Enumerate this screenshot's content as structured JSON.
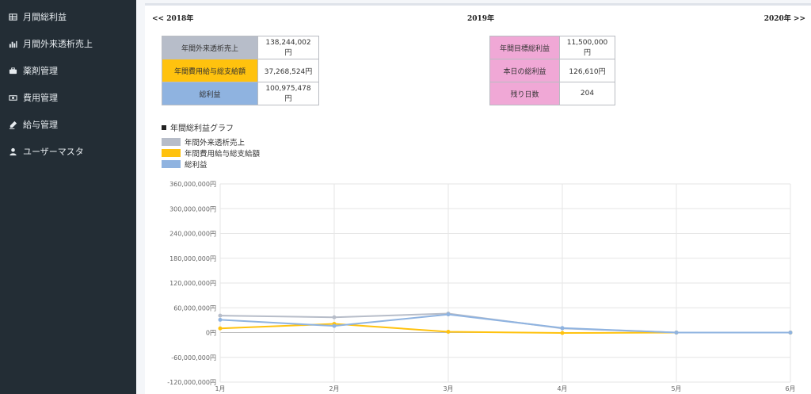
{
  "sidebar": {
    "items": [
      {
        "label": "月間総利益",
        "icon": "table-icon"
      },
      {
        "label": "月間外来透析売上",
        "icon": "bar-chart-icon"
      },
      {
        "label": "薬剤管理",
        "icon": "briefcase-icon"
      },
      {
        "label": "費用管理",
        "icon": "money-icon"
      },
      {
        "label": "給与管理",
        "icon": "pen-icon"
      },
      {
        "label": "ユーザーマスタ",
        "icon": "user-icon"
      }
    ]
  },
  "year_nav": {
    "prev": "<< 2018年",
    "current": "2019年",
    "next": "2020年 >>"
  },
  "summary_left": [
    {
      "label": "年間外来透析売上",
      "value": "138,244,002円",
      "color": "#b7bdc9"
    },
    {
      "label": "年間費用給与総支給額",
      "value": "37,268,524円",
      "color": "#ffc20e"
    },
    {
      "label": "総利益",
      "value": "100,975,478円",
      "color": "#8fb3e0"
    }
  ],
  "summary_right": [
    {
      "label": "年間目標総利益",
      "value": "11,500,000円",
      "color": "#f0a8d6"
    },
    {
      "label": "本日の総利益",
      "value": "126,610円",
      "color": "#f0a8d6"
    },
    {
      "label": "残り日数",
      "value": "204",
      "color": "#f0a8d6"
    }
  ],
  "graph_title": "年間総利益グラフ",
  "chart_data": {
    "type": "line",
    "title": "",
    "x": [
      "1月",
      "2月",
      "3月",
      "4月",
      "5月",
      "6月"
    ],
    "ylim": [
      -120000000,
      360000000
    ],
    "yticks": [
      {
        "value": 360000000,
        "label": "360,000,000円"
      },
      {
        "value": 300000000,
        "label": "300,000,000円"
      },
      {
        "value": 240000000,
        "label": "240,000,000円"
      },
      {
        "value": 180000000,
        "label": "180,000,000円"
      },
      {
        "value": 120000000,
        "label": "120,000,000円"
      },
      {
        "value": 60000000,
        "label": "60,000,000円"
      },
      {
        "value": 0,
        "label": "0円"
      },
      {
        "value": -60000000,
        "label": "-60,000,000円"
      },
      {
        "value": -120000000,
        "label": "-120,000,000円"
      }
    ],
    "grid": true,
    "legend_position": "top-left",
    "series": [
      {
        "name": "年間外来透析売上",
        "color": "#b7bdc9",
        "values": [
          41000000,
          37000000,
          46000000,
          10000000,
          0,
          0
        ]
      },
      {
        "name": "年間費用給与総支給額",
        "color": "#ffc20e",
        "values": [
          10000000,
          21000000,
          2000000,
          -1000000,
          0,
          0
        ]
      },
      {
        "name": "総利益",
        "color": "#8fb3e0",
        "values": [
          31000000,
          16000000,
          44000000,
          11000000,
          0,
          0
        ]
      }
    ]
  }
}
